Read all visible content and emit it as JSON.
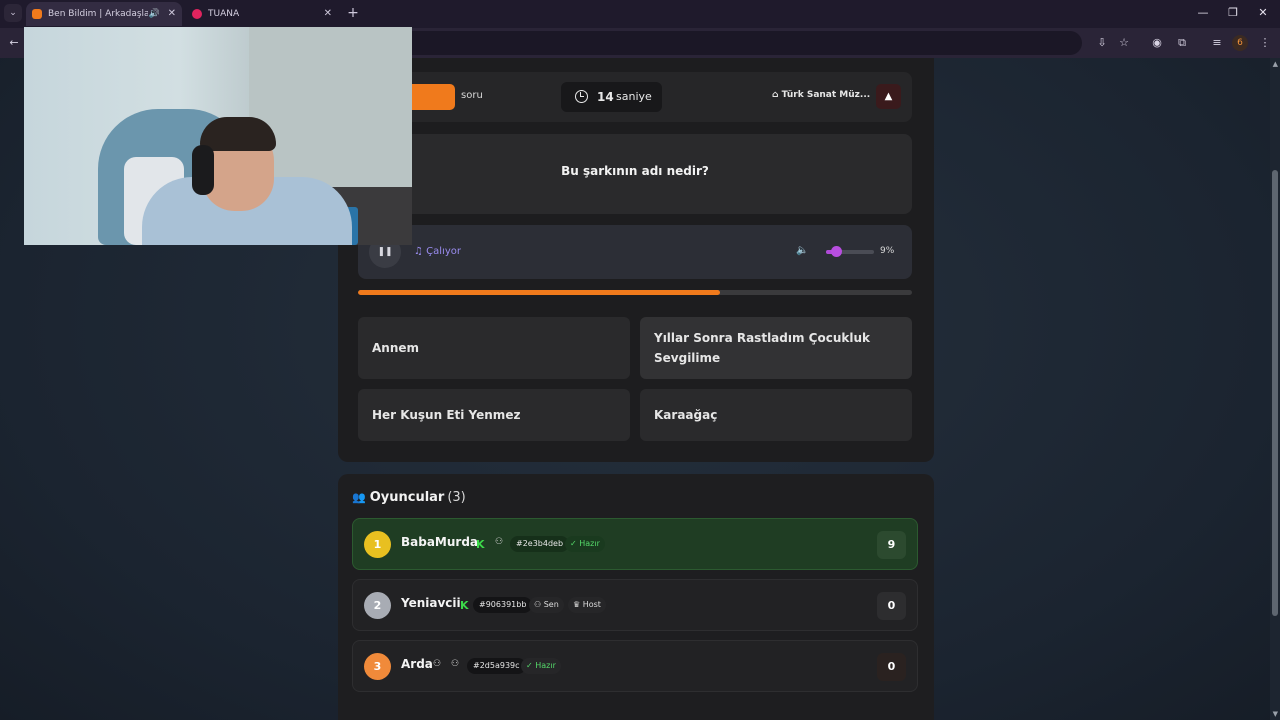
{
  "browser": {
    "tabs": [
      {
        "title": "Ben Bildim | Arkadaşlarınla Oyna",
        "active": true,
        "audio": true
      },
      {
        "title": "TUANA",
        "active": false
      }
    ],
    "profile_badge": "6"
  },
  "icons": {
    "tab_list": "chevron-down-icon",
    "speaker": "speaker-icon",
    "close": "close-icon",
    "new_tab": "plus-icon",
    "back": "back-arrow-icon",
    "install": "install-icon",
    "star": "star-icon",
    "extensions": "puzzle-icon",
    "media": "media-control-icon",
    "menu": "kebab-menu-icon",
    "clock": "clock-icon",
    "tag": "tag-icon",
    "warning": "warning-icon",
    "pause": "pause-icon",
    "music": "music-note-icon",
    "volume": "volume-icon",
    "users": "users-icon",
    "kick": "kick-icon",
    "crown": "crown-icon",
    "check": "check-circle-icon"
  },
  "colors": {
    "accent_orange": "#f07a1c",
    "playing_purple": "#9a8cf0",
    "volume_purple": "#b84ee0",
    "ready_green": "#55d96a",
    "leader_bg": "#1f3d23",
    "kick_green": "#3cd94a"
  },
  "game": {
    "question_count_suffix": "soru",
    "timer": {
      "value": "14",
      "unit": "saniye"
    },
    "category": "Türk Sanat Müz...",
    "question": "Bu şarkının adı nedir?",
    "player": {
      "status": "Çalıyor",
      "volume_percent": 9,
      "volume_label": "9%"
    },
    "progress_fraction": 0.653,
    "answers": [
      {
        "text": "Annem"
      },
      {
        "text": "Yıllar Sonra Rastladım Çocukluk Sevgilime"
      },
      {
        "text": "Her Kuşun Eti Yenmez"
      },
      {
        "text": "Karaağaç"
      }
    ]
  },
  "players": {
    "title": "Oyuncular",
    "count": "(3)",
    "list": [
      {
        "rank": "1",
        "name": "BabaMurda",
        "id": "#2e3b4deb",
        "tags": [
          "Hazır"
        ],
        "score": "9",
        "rank_color": "#e8c020"
      },
      {
        "rank": "2",
        "name": "Yeniavcii",
        "id": "#906391bb",
        "tags": [
          "Sen",
          "Host"
        ],
        "score": "0",
        "rank_color": "#a8acb4"
      },
      {
        "rank": "3",
        "name": "Arda",
        "id": "#2d5a939c",
        "tags": [
          "Hazır"
        ],
        "score": "0",
        "rank_color": "#f08a3a"
      }
    ]
  }
}
